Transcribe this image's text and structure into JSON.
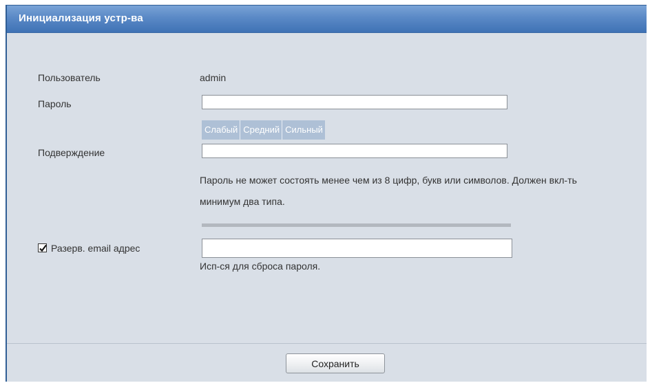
{
  "window": {
    "title": "Инициализация устр-ва"
  },
  "form": {
    "user_label": "Пользователь",
    "user_value": "admin",
    "password_label": "Пароль",
    "password_value": "",
    "strength": {
      "weak": "Слабый",
      "medium": "Средний",
      "strong": "Сильный"
    },
    "confirm_label": "Подверждение",
    "confirm_value": "",
    "password_hint": "Пароль не может состоять менее чем из 8 цифр, букв или символов. Должен вкл-ть минимум два типа.",
    "email_checkbox_checked": true,
    "email_label": "Разерв. email адрес",
    "email_value": "",
    "email_hint": "Исп-ся для сброса пароля."
  },
  "footer": {
    "save_label": "Сохранить"
  },
  "colors": {
    "title_bar": "#4f80c0",
    "background": "#d9dfe7",
    "strength_bar": "#aec0d6"
  },
  "icons": {
    "checkbox": "check-icon"
  }
}
